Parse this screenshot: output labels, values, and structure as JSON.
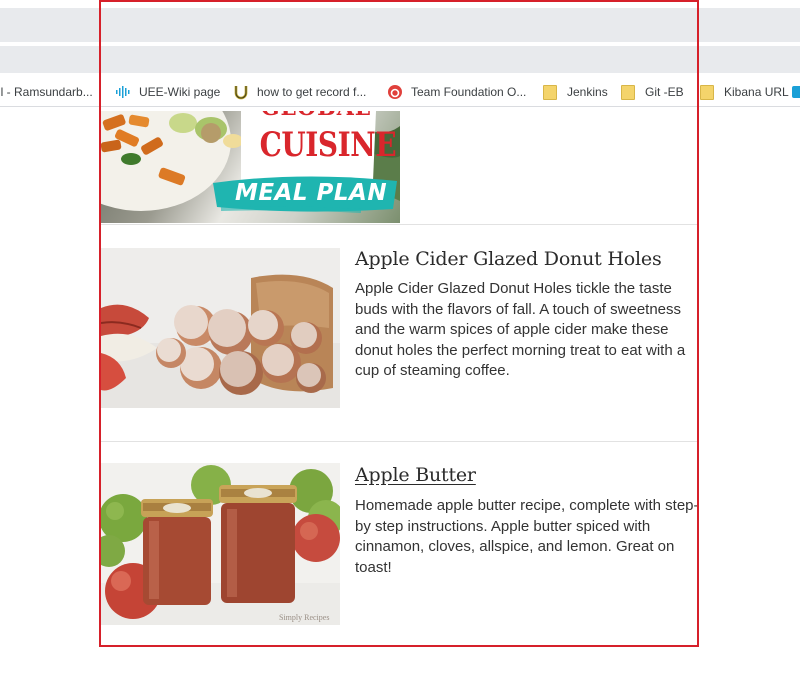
{
  "browser": {
    "bookmarks": [
      {
        "label": "il - Ramsundarb...",
        "icon": "none"
      },
      {
        "label": "UEE-Wiki page",
        "icon": "cisco-icon"
      },
      {
        "label": "how to get record f...",
        "icon": "horseshoe-icon"
      },
      {
        "label": "Team Foundation O...",
        "icon": "tfs-icon"
      },
      {
        "label": "Jenkins",
        "icon": "folder-icon"
      },
      {
        "label": "Git -EB",
        "icon": "folder-icon"
      },
      {
        "label": "Kibana URL",
        "icon": "folder-icon"
      }
    ]
  },
  "banner": {
    "line1": "GLOBAL",
    "line2": "CUISINE",
    "line3": "MEAL PLAN"
  },
  "recipes": [
    {
      "title": "Apple Cider Glazed Donut Holes",
      "description": "Apple Cider Glazed Donut Holes tickle the taste buds with the flavors of fall. A touch of sweetness and the warm spices of apple cider make these donut holes the perfect morning treat to eat with a cup of steaming coffee."
    },
    {
      "title": "Apple Butter",
      "description": "Homemade apple butter recipe, complete with step-by step instructions. Apple butter spiced with cinnamon, cloves, allspice, and lemon. Great on toast!",
      "jar_label": "Simply Recipes"
    }
  ],
  "colors": {
    "selection_frame": "#d6202a",
    "banner_red": "#d9262c",
    "banner_teal": "#1fb5b0"
  }
}
